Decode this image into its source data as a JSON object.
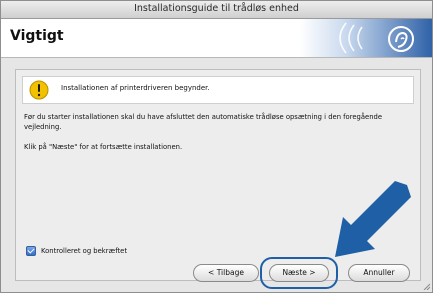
{
  "window": {
    "title": "Installationsguide til trådløs enhed"
  },
  "header": {
    "heading": "Vigtigt"
  },
  "notice": {
    "text": "Installationen af printerdriveren begynder."
  },
  "body": {
    "paragraph1": "Før du starter installationen skal du have afsluttet den automatiske trådløse opsætning i den foregående vejledning.",
    "paragraph2": "Klik på \"Næste\" for at fortsætte installationen."
  },
  "checkbox": {
    "label": "Kontrolleret og bekræftet",
    "checked": true
  },
  "buttons": {
    "back": "< Tilbage",
    "next": "Næste >",
    "cancel": "Annuller"
  },
  "colors": {
    "accent": "#1f5fa6",
    "banner": "#2f62a8",
    "warning": "#f2c200"
  },
  "icons": {
    "warning": "warning-icon",
    "wireless": "wireless-logo-icon",
    "arrow": "pointer-arrow-icon"
  }
}
